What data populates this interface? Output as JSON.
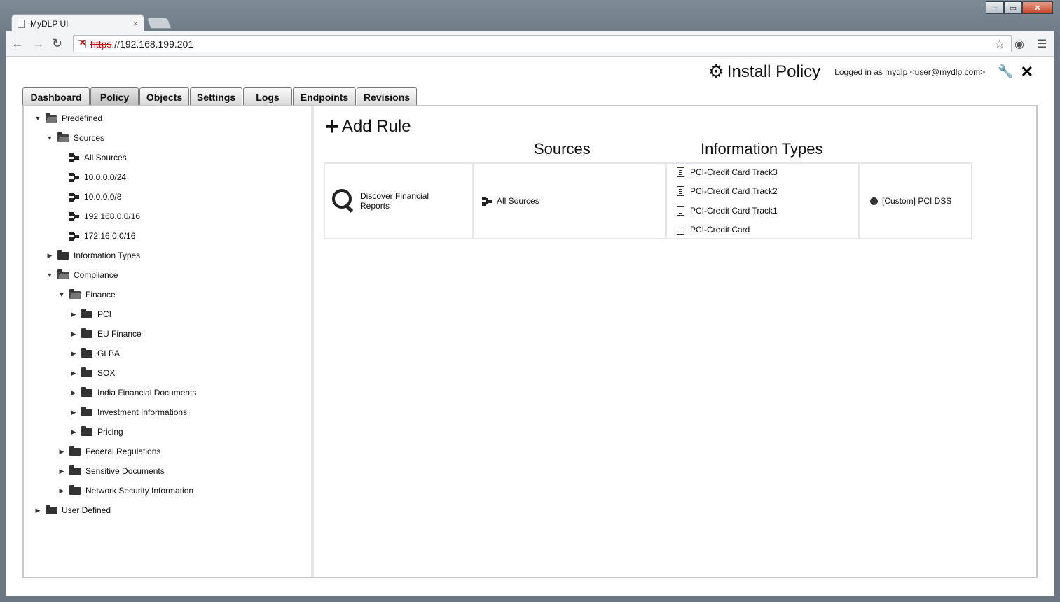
{
  "browser": {
    "tab_title": "MyDLP UI",
    "url_scheme": "https",
    "url_rest": "://192.168.199.201"
  },
  "header": {
    "install_label": "Install Policy",
    "logged_in_text": "Logged in as mydlp <user@mydlp.com>"
  },
  "nav_tabs": [
    "Dashboard",
    "Policy",
    "Objects",
    "Settings",
    "Logs",
    "Endpoints",
    "Revisions"
  ],
  "active_tab": "Policy",
  "tree": {
    "predefined": "Predefined",
    "sources": "Sources",
    "source_items": [
      "All Sources",
      "10.0.0.0/24",
      "10.0.0.0/8",
      "192.168.0.0/16",
      "172.16.0.0/16"
    ],
    "information_types": "Information Types",
    "compliance": "Compliance",
    "finance": "Finance",
    "finance_items": [
      "PCI",
      "EU Finance",
      "GLBA",
      "SOX",
      "India Financial Documents",
      "Investment Informations",
      "Pricing"
    ],
    "federal_regulations": "Federal Regulations",
    "sensitive_documents": "Sensitive Documents",
    "network_security_information": "Network Security Information",
    "user_defined": "User Defined"
  },
  "main": {
    "add_rule": "Add Rule",
    "col_sources": "Sources",
    "col_information_types": "Information Types",
    "rule": {
      "name_line1": "Discover Financial",
      "name_line2": "Reports",
      "source": "All Sources",
      "info_types": [
        "PCI-Credit Card Track3",
        "PCI-Credit Card Track2",
        "PCI-Credit Card Track1",
        "PCI-Credit Card"
      ],
      "action": "[Custom] PCI DSS"
    }
  }
}
